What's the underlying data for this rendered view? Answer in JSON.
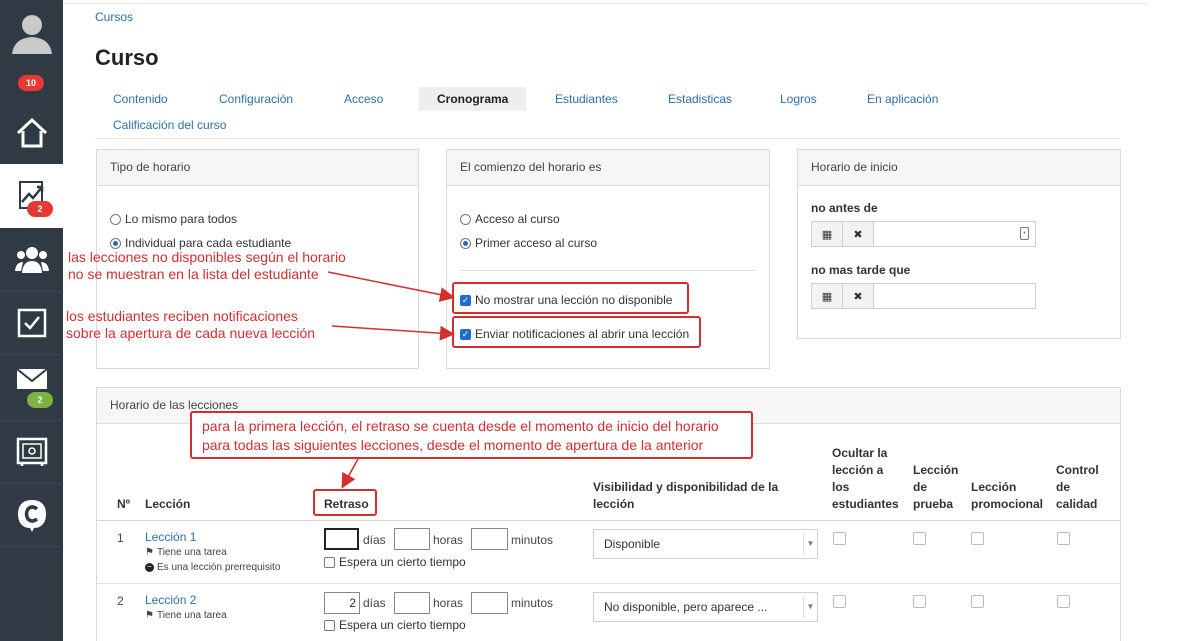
{
  "sidebar": {
    "badges": {
      "avatar": "10",
      "courses": "2",
      "messages": "2"
    }
  },
  "breadcrumb": "Cursos",
  "page_title": "Curso",
  "tabs": [
    {
      "label": "Contenido"
    },
    {
      "label": "Configuración"
    },
    {
      "label": "Acceso"
    },
    {
      "label": "Cronograma"
    },
    {
      "label": "Estudiantes"
    },
    {
      "label": "Estadisticas"
    },
    {
      "label": "Logros"
    },
    {
      "label": "En aplicación"
    },
    {
      "label": "Calificación del curso"
    }
  ],
  "schedule_type": {
    "title": "Tipo de horario",
    "options": [
      "Lo mismo para todos",
      "Individual para cada estudiante"
    ]
  },
  "schedule_start": {
    "title": "El comienzo del horario es",
    "options": [
      "Acceso al curso",
      "Primer acceso al curso"
    ],
    "hide_unavailable": "No mostrar una lección no disponible",
    "send_notifications": "Enviar notificaciones al abrir una lección"
  },
  "start_time": {
    "title": "Horario de inicio",
    "not_before": "no antes de",
    "not_later": "no mas tarde que"
  },
  "annotations": {
    "hide_line1": "las lecciones no disponibles según el horario",
    "hide_line2": "no se muestran en la lista del estudiante",
    "notif_line1": "los estudiantes reciben notificaciones",
    "notif_line2": "sobre la apertura de cada nueva lección",
    "delay_line1": "para la primera lección, el retraso se cuenta desde el momento de inicio del horario",
    "delay_line2": "para todas las siguientes lecciones, desde el momento de apertura de la anterior"
  },
  "lessons_schedule": {
    "title": "Horario de las lecciones",
    "headers": {
      "no": "Nº",
      "lesson": "Lección",
      "delay": "Retraso",
      "visibility": "Visibilidad y disponibilidad de la lección",
      "hide": "Ocultar la lección a los estudiantes",
      "trial": "Lección de prueba",
      "promo": "Lección promocional",
      "quality": "Control de calidad"
    },
    "units": {
      "days": "días",
      "hours": "horas",
      "minutes": "minutos",
      "wait": "Espera un cierto tiempo"
    },
    "rows": [
      {
        "no": "1",
        "name": "Lección 1",
        "has_task": "Tiene una tarea",
        "prereq": "Es una lección prerrequisito",
        "days": "",
        "visibility": "Disponible"
      },
      {
        "no": "2",
        "name": "Lección 2",
        "has_task": "Tiene una tarea",
        "days": "2",
        "visibility": "No disponible, pero aparece ..."
      }
    ]
  }
}
